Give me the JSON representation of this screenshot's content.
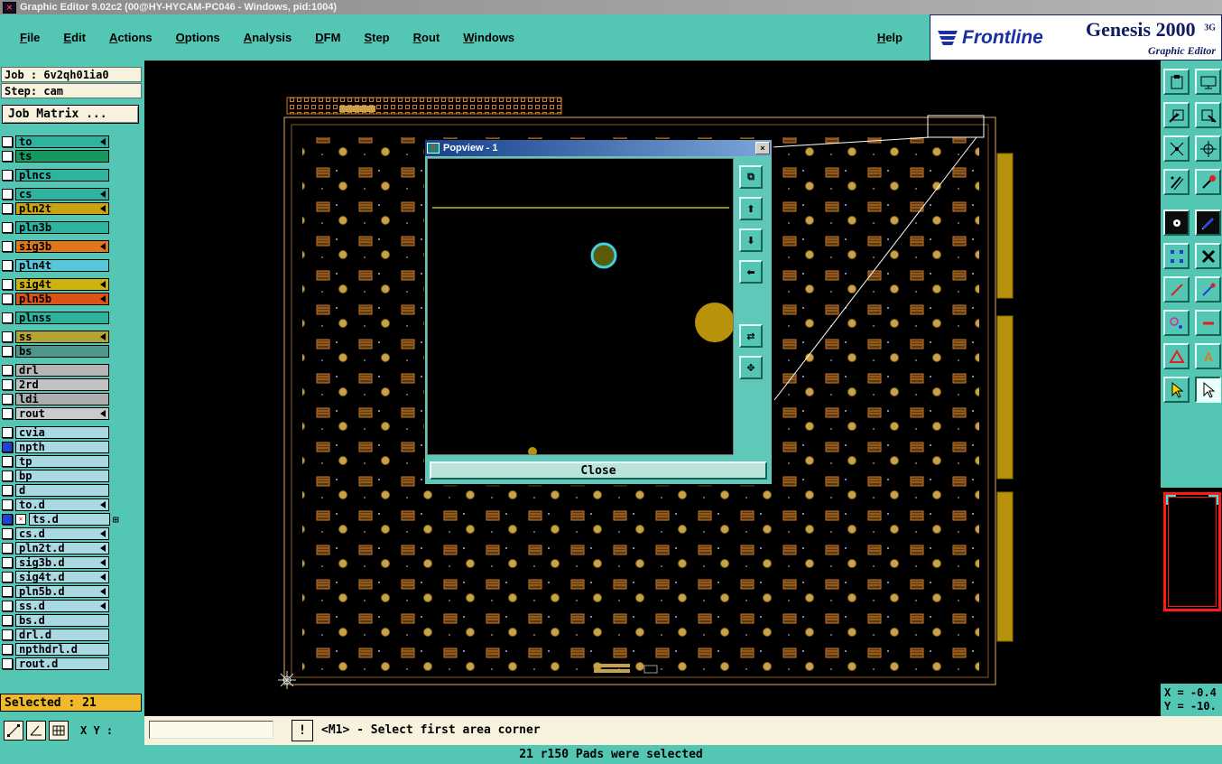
{
  "titlebar": {
    "title": "Graphic Editor 9.02c2 (00@HY-HYCAM-PC046 - Windows, pid:1004)"
  },
  "menubar": {
    "items": [
      "File",
      "Edit",
      "Actions",
      "Options",
      "Analysis",
      "DFM",
      "Step",
      "Rout",
      "Windows"
    ],
    "help": "Help"
  },
  "brand": {
    "logo": "Frontline",
    "product": "Genesis 2000",
    "edition": "3G",
    "tagline": "Graphic Editor"
  },
  "job_panel": {
    "job": "Job : 6v2qh01ia0",
    "step": "Step: cam",
    "matrix": "Job Matrix ..."
  },
  "layers": [
    {
      "name": "to",
      "color": "#2fb39e",
      "arrow": true,
      "gap": false,
      "checkbox": "white"
    },
    {
      "name": "ts",
      "color": "#16995f",
      "arrow": false,
      "gap": false,
      "checkbox": "white"
    },
    {
      "name": "plncs",
      "color": "#2fb39e",
      "arrow": false,
      "gap": true,
      "checkbox": "white"
    },
    {
      "name": "cs",
      "color": "#2fb39e",
      "arrow": true,
      "gap": true,
      "checkbox": "white"
    },
    {
      "name": "pln2t",
      "color": "#c9a410",
      "arrow": true,
      "gap": false,
      "checkbox": "white"
    },
    {
      "name": "pln3b",
      "color": "#2fb39e",
      "arrow": false,
      "gap": true,
      "checkbox": "white"
    },
    {
      "name": "sig3b",
      "color": "#e2761b",
      "arrow": true,
      "gap": true,
      "checkbox": "white"
    },
    {
      "name": "pln4t",
      "color": "#56c6d8",
      "arrow": false,
      "gap": true,
      "checkbox": "white"
    },
    {
      "name": "sig4t",
      "color": "#cdb30d",
      "arrow": true,
      "gap": true,
      "checkbox": "white"
    },
    {
      "name": "pln5b",
      "color": "#de5214",
      "arrow": true,
      "gap": false,
      "checkbox": "white"
    },
    {
      "name": "plnss",
      "color": "#2fb39e",
      "arrow": false,
      "gap": true,
      "checkbox": "white"
    },
    {
      "name": "ss",
      "color": "#b3a433",
      "arrow": true,
      "gap": true,
      "checkbox": "white"
    },
    {
      "name": "bs",
      "color": "#4f968b",
      "arrow": false,
      "gap": false,
      "checkbox": "white"
    },
    {
      "name": "drl",
      "color": "#b5b5b5",
      "arrow": false,
      "gap": true,
      "checkbox": "white"
    },
    {
      "name": "2rd",
      "color": "#c2c2c2",
      "arrow": false,
      "gap": false,
      "checkbox": "white"
    },
    {
      "name": "ldi",
      "color": "#aeaeae",
      "arrow": false,
      "gap": false,
      "checkbox": "white"
    },
    {
      "name": "rout",
      "color": "#cbcbcb",
      "arrow": true,
      "gap": false,
      "checkbox": "white"
    },
    {
      "name": "cvia",
      "color": "#a9d9e2",
      "arrow": false,
      "gap": true,
      "checkbox": "white"
    },
    {
      "name": "npth",
      "color": "#a9d9e2",
      "arrow": false,
      "gap": false,
      "checkbox": "blue"
    },
    {
      "name": "tp",
      "color": "#a9d9e2",
      "arrow": false,
      "gap": false,
      "checkbox": "white"
    },
    {
      "name": "bp",
      "color": "#a9d9e2",
      "arrow": false,
      "gap": false,
      "checkbox": "white"
    },
    {
      "name": "d",
      "color": "#a9d9e2",
      "arrow": false,
      "gap": false,
      "checkbox": "white"
    },
    {
      "name": "to.d",
      "color": "#a9d9e2",
      "arrow": true,
      "gap": false,
      "checkbox": "white"
    },
    {
      "name": "ts.d",
      "color": "#a9d9e2",
      "arrow": false,
      "gap": false,
      "checkbox": "blue",
      "special": "work"
    },
    {
      "name": "cs.d",
      "color": "#a9d9e2",
      "arrow": true,
      "gap": false,
      "checkbox": "white"
    },
    {
      "name": "pln2t.d",
      "color": "#a9d9e2",
      "arrow": true,
      "gap": false,
      "checkbox": "white"
    },
    {
      "name": "sig3b.d",
      "color": "#a9d9e2",
      "arrow": true,
      "gap": false,
      "checkbox": "white"
    },
    {
      "name": "sig4t.d",
      "color": "#a9d9e2",
      "arrow": true,
      "gap": false,
      "checkbox": "white"
    },
    {
      "name": "pln5b.d",
      "color": "#a9d9e2",
      "arrow": true,
      "gap": false,
      "checkbox": "white"
    },
    {
      "name": "ss.d",
      "color": "#a9d9e2",
      "arrow": true,
      "gap": false,
      "checkbox": "white"
    },
    {
      "name": "bs.d",
      "color": "#a9d9e2",
      "arrow": false,
      "gap": false,
      "checkbox": "white"
    },
    {
      "name": "drl.d",
      "color": "#a9d9e2",
      "arrow": false,
      "gap": false,
      "checkbox": "white"
    },
    {
      "name": "npthdrl.d",
      "color": "#a9d9e2",
      "arrow": false,
      "gap": false,
      "checkbox": "white"
    },
    {
      "name": "rout.d",
      "color": "#a9d9e2",
      "arrow": false,
      "gap": false,
      "checkbox": "white"
    }
  ],
  "selected": {
    "label": "Selected : 21"
  },
  "popview": {
    "title": "Popview - 1",
    "close_x": "×",
    "close": "Close"
  },
  "coords": {
    "x": "X = -0.4",
    "y": "Y = -10."
  },
  "bottom": {
    "xy": "X Y :",
    "input": "",
    "alert": "!",
    "prompt": "<M1> - Select first area corner"
  },
  "status": {
    "message": "21 r150 Pads were selected"
  },
  "colors": {
    "teal": "#53c7b4",
    "cream": "#f7f2dd",
    "selected_bar": "#efb929",
    "overview_red": "#ff1a1a"
  }
}
